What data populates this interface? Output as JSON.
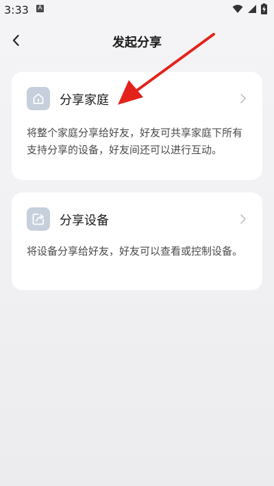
{
  "status_bar": {
    "time": "3:33",
    "badge": "A"
  },
  "header": {
    "title": "发起分享"
  },
  "cards": [
    {
      "title": "分享家庭",
      "description": "将整个家庭分享给好友，好友可共享家庭下所有支持分享的设备，好友间还可以进行互动。",
      "icon": "home-icon"
    },
    {
      "title": "分享设备",
      "description": "将设备分享给好友，好友可以查看或控制设备。",
      "icon": "share-device-icon"
    }
  ],
  "colors": {
    "accent_arrow": "#e3231b",
    "icon_bg": "#c6cfdb",
    "card_bg": "#ffffff",
    "page_bg": "#f2f2f4"
  }
}
